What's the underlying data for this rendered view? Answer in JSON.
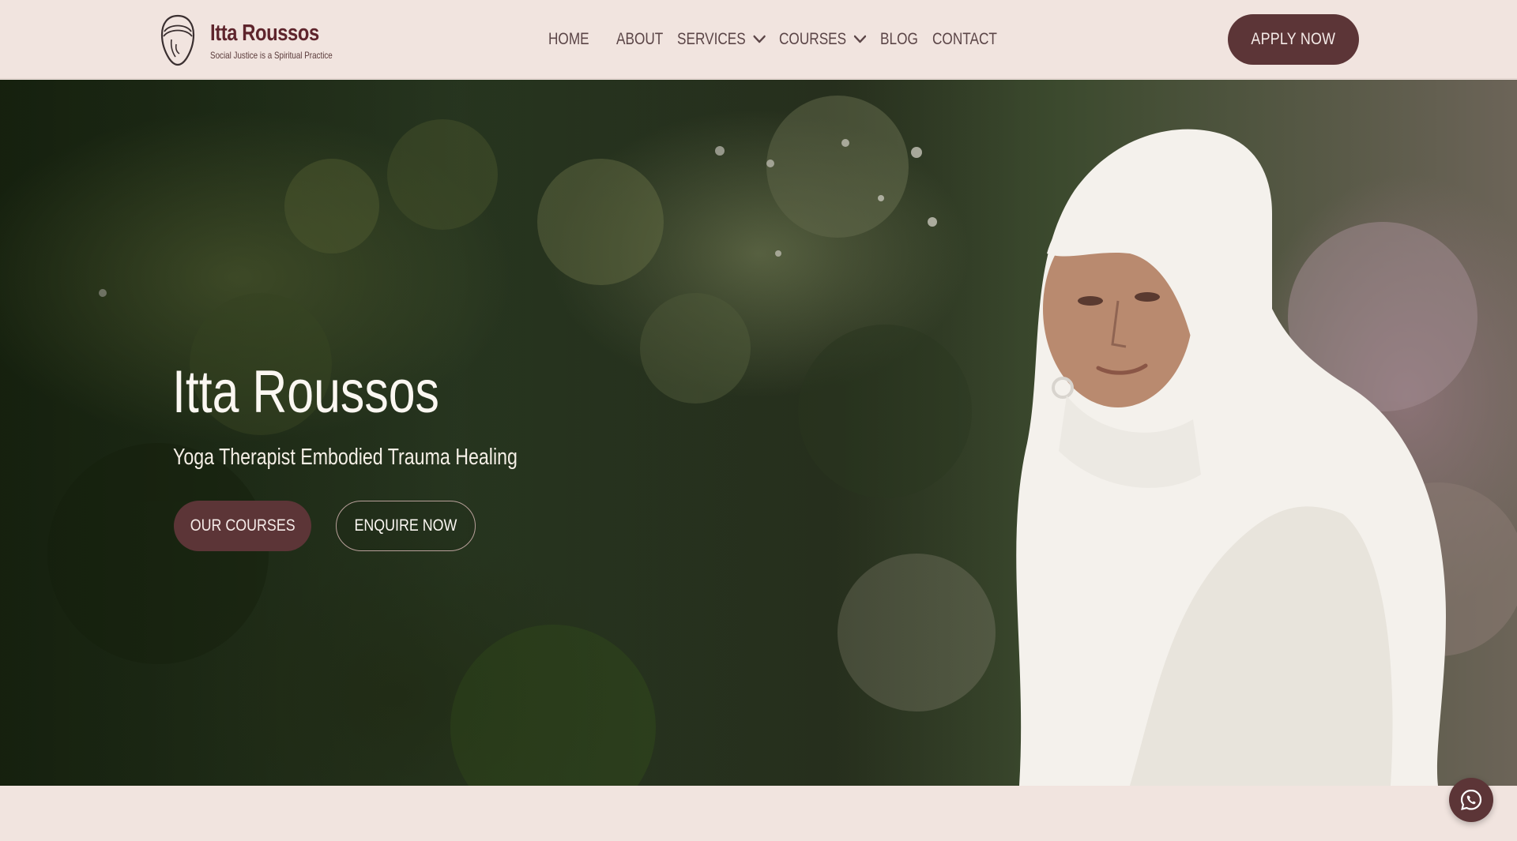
{
  "brand": {
    "name": "Itta Roussos",
    "tagline": "Social Justice is a Spiritual Practice",
    "logo_icon": "meditating-figure-icon"
  },
  "nav": {
    "items": [
      {
        "label": "HOME",
        "has_dropdown": false
      },
      {
        "label": "ABOUT",
        "has_dropdown": false
      },
      {
        "label": "SERVICES",
        "has_dropdown": true
      },
      {
        "label": "COURSES",
        "has_dropdown": true
      },
      {
        "label": "BLOG",
        "has_dropdown": false
      },
      {
        "label": "CONTACT",
        "has_dropdown": false
      }
    ],
    "apply_label": "APPLY NOW"
  },
  "hero": {
    "title": "Itta Roussos",
    "subtitle": "Yoga Therapist Embodied Trauma Healing",
    "primary_cta": "OUR COURSES",
    "secondary_cta": "ENQUIRE NOW"
  },
  "floating": {
    "icon": "whatsapp-icon"
  },
  "colors": {
    "background": "#f1e4df",
    "brand": "#5e242c",
    "button": "#5c3537",
    "text_light": "#fbf7f2"
  }
}
